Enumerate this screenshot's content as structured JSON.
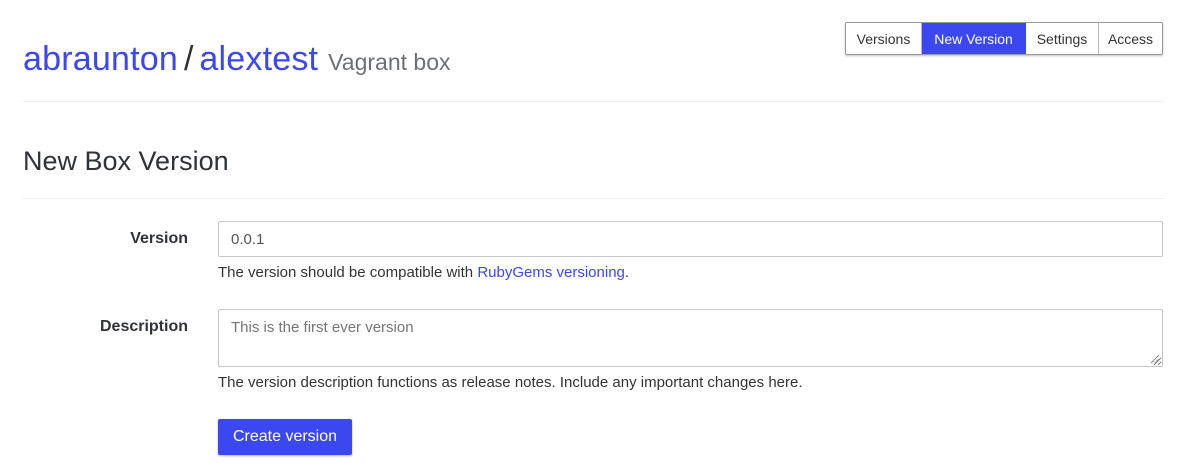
{
  "header": {
    "owner": "abraunton",
    "separator": "/",
    "box_name": "alextest",
    "box_type": "Vagrant box"
  },
  "tabs": [
    {
      "label": "Versions",
      "active": false
    },
    {
      "label": "New Version",
      "active": true
    },
    {
      "label": "Settings",
      "active": false
    },
    {
      "label": "Access",
      "active": false
    }
  ],
  "section_title": "New Box Version",
  "form": {
    "version": {
      "label": "Version",
      "value": "0.0.1",
      "help_prefix": "The version should be compatible with ",
      "help_link": "RubyGems versioning",
      "help_suffix": "."
    },
    "description": {
      "label": "Description",
      "placeholder": "This is the first ever version",
      "help": "The version description functions as release notes. Include any important changes here."
    },
    "submit_label": "Create version"
  },
  "colors": {
    "accent": "#3b48f0"
  }
}
